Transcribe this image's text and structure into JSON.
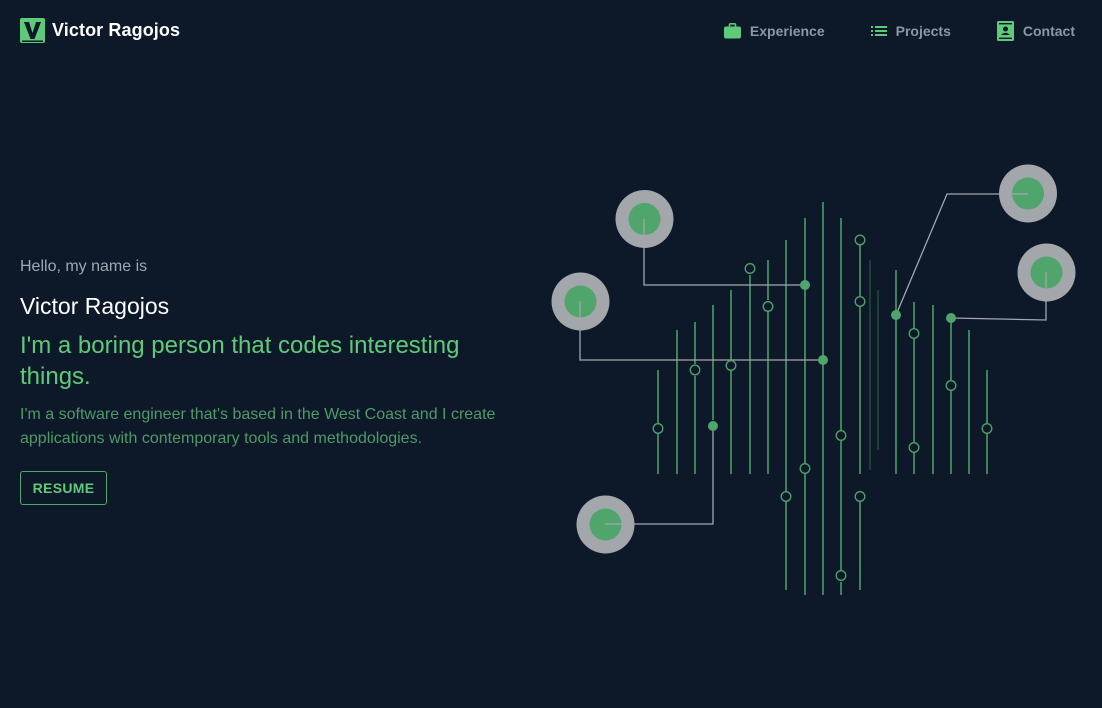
{
  "brand": {
    "name": "Victor Ragojos",
    "logo_icon": "v-logo-icon",
    "accent_color": "#5fcb7a"
  },
  "nav": {
    "items": [
      {
        "label": "Experience",
        "icon": "briefcase-icon"
      },
      {
        "label": "Projects",
        "icon": "list-icon"
      },
      {
        "label": "Contact",
        "icon": "contact-card-icon"
      }
    ]
  },
  "hero": {
    "greeting": "Hello, my name is",
    "name": "Victor Ragojos",
    "tagline": "I'm a boring person that codes interesting things.",
    "description": "I'm a software engineer that's based in the West Coast and I create applications with contemporary tools and methodologies.",
    "resume_label": "RESUME"
  },
  "illustration": {
    "icon": "circuit-board-illustration",
    "line_color": "#4fa56c",
    "node_outer_color": "#a3a6ab",
    "node_inner_color": "#4fa56c"
  },
  "colors": {
    "background": "#0d1828",
    "accent": "#5fcb7a",
    "muted_text": "#8e96a3"
  }
}
